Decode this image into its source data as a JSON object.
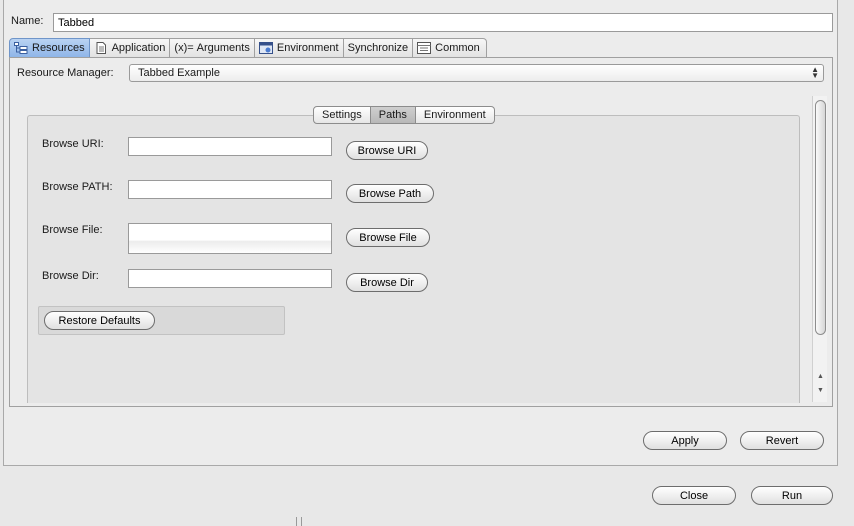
{
  "name_field": {
    "label": "Name:",
    "value": "Tabbed"
  },
  "tabs": [
    {
      "label": "Resources",
      "icon": "resources-icon",
      "active": true
    },
    {
      "label": "Application",
      "icon": "application-icon",
      "active": false
    },
    {
      "label": "Arguments",
      "icon": "arguments-icon",
      "icon_text": "(x)=",
      "active": false
    },
    {
      "label": "Environment",
      "icon": "environment-icon",
      "active": false
    },
    {
      "label": "Synchronize",
      "icon": "",
      "active": false
    },
    {
      "label": "Common",
      "icon": "common-icon",
      "active": false
    }
  ],
  "resource_manager": {
    "label": "Resource Manager:",
    "value": "Tabbed Example"
  },
  "inner_tabs": [
    {
      "label": "Settings",
      "active": false
    },
    {
      "label": "Paths",
      "active": true
    },
    {
      "label": "Environment",
      "active": false
    }
  ],
  "paths": {
    "browse_uri": {
      "label": "Browse URI:",
      "button": "Browse URI",
      "value": ""
    },
    "browse_path": {
      "label": "Browse PATH:",
      "button": "Browse Path",
      "value": ""
    },
    "browse_file": {
      "label": "Browse File:",
      "button": "Browse File",
      "value": ""
    },
    "browse_dir": {
      "label": "Browse Dir:",
      "button": "Browse Dir",
      "value": ""
    },
    "restore_defaults": "Restore Defaults"
  },
  "actions": {
    "apply": "Apply",
    "revert": "Revert",
    "close": "Close",
    "run": "Run"
  },
  "colors": {
    "active_tab": "#8fb5e8",
    "window_bg": "#e8e8e8"
  }
}
